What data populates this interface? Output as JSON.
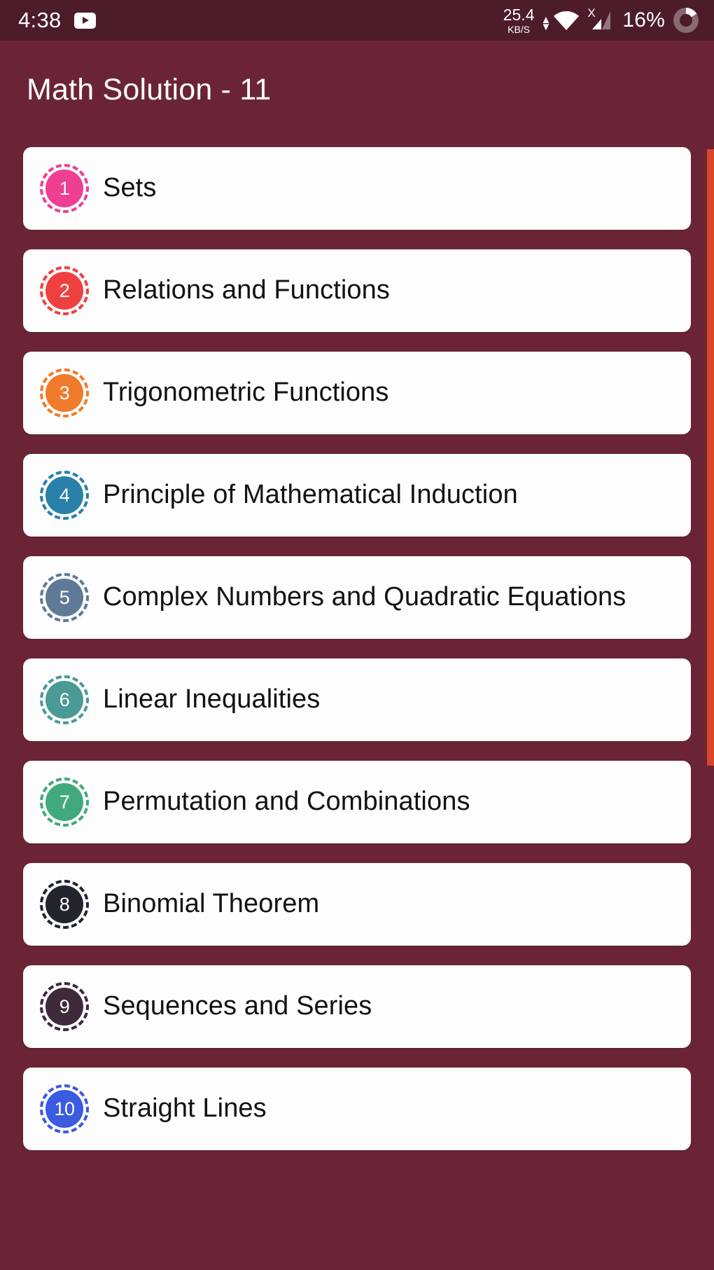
{
  "status_bar": {
    "clock": "4:38",
    "media_icon": "youtube-play-icon",
    "net_speed_value": "25.4",
    "net_speed_unit": "KB/S",
    "wifi_icon": "wifi-signal-icon",
    "wifi_transfer_icon": "up-down-arrows-icon",
    "cellular_icon": "cellular-signal-icon",
    "cellular_no_service": "X",
    "battery_percent": "16%",
    "battery_icon": "battery-ring-icon",
    "background_color": "#4C1C29"
  },
  "app_bar": {
    "title": "Math Solution - 11",
    "background_color": "#6B2436",
    "text_color": "#FFFFFF"
  },
  "theme": {
    "page_background": "#6B2436",
    "card_background": "#FDFDFD",
    "card_text": "#121212",
    "scrollbar_thumb": "#D9472B"
  },
  "chapters": [
    {
      "number": "1",
      "title": "Sets",
      "color": "#EE3F92"
    },
    {
      "number": "2",
      "title": "Relations and Functions",
      "color": "#EF4040"
    },
    {
      "number": "3",
      "title": "Trigonometric Functions",
      "color": "#F07B2B"
    },
    {
      "number": "4",
      "title": "Principle of Mathematical Induction",
      "color": "#2980A8"
    },
    {
      "number": "5",
      "title": "Complex Numbers and Quadratic Equations",
      "color": "#5E7A96"
    },
    {
      "number": "6",
      "title": "Linear Inequalities",
      "color": "#4A9A96"
    },
    {
      "number": "7",
      "title": "Permutation and Combinations",
      "color": "#42A97E"
    },
    {
      "number": "8",
      "title": "Binomial Theorem",
      "color": "#22252B"
    },
    {
      "number": "9",
      "title": "Sequences and Series",
      "color": "#3E2A3A"
    },
    {
      "number": "10",
      "title": "Straight Lines",
      "color": "#3B5BE0"
    }
  ]
}
